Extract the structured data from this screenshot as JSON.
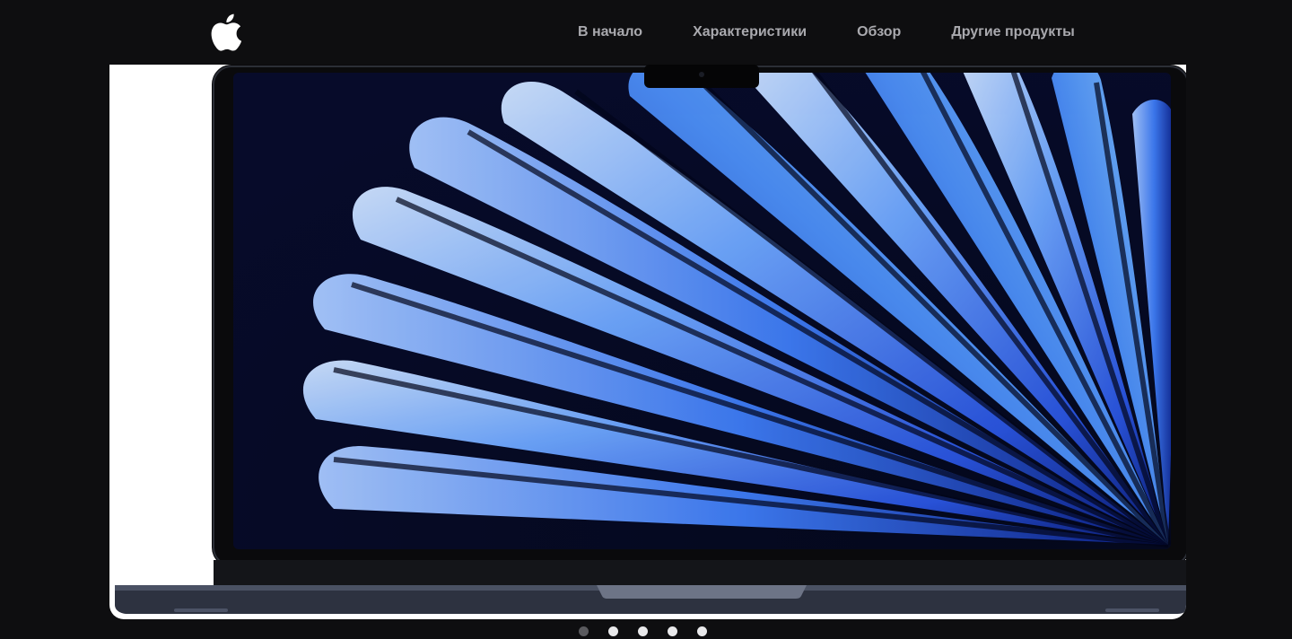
{
  "header": {
    "logo_icon": "apple-logo-icon",
    "nav": [
      {
        "label": "В начало"
      },
      {
        "label": "Характеристики"
      },
      {
        "label": "Обзор"
      },
      {
        "label": "Другие продукты"
      }
    ]
  },
  "hero": {
    "image": "macbook-air-front-blue-wallpaper"
  },
  "carousel": {
    "slide_count": 5,
    "active_index": 0
  },
  "colors": {
    "background": "#0e0e10",
    "nav_text": "#a9a9ae",
    "dot_active": "#5a5a5e",
    "dot_inactive": "#e8e8ea"
  }
}
